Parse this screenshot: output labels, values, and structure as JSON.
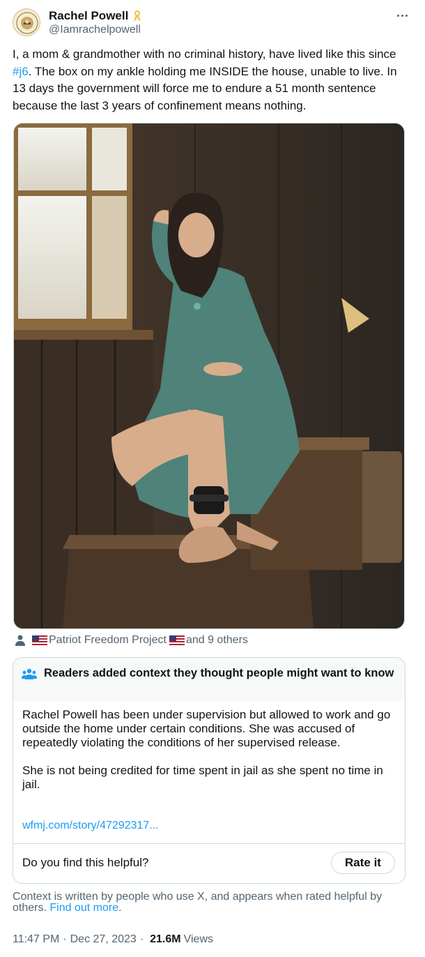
{
  "author": {
    "display_name": "Rachel Powell",
    "handle": "@Iamrachelpowell",
    "avatar_icon": "profile-avatar-icon",
    "badge_icon": "gold-ribbon-icon"
  },
  "tweet": {
    "text_before_hashtag": "I, a mom & grandmother with no criminal history, have lived like this since ",
    "hashtag": "#j6",
    "text_after_hashtag": ". The box on my ankle holding me INSIDE the house, unable to live. In 13 days the government will force me to endure a 51 month sentence because the last 3 years of confinement means nothing."
  },
  "tags": {
    "first": "Patriot Freedom Project",
    "rest": "and 9 others"
  },
  "community_note": {
    "title": "Readers added context they thought people might want to know",
    "paragraph_1": "Rachel Powell has been under supervision but allowed to work and go outside the home under certain conditions.  She was accused of repeatedly violating the conditions of her supervised release.",
    "paragraph_2": "She is not being credited for time spent in jail as she spent no time in jail.",
    "link": "wfmj.com/story/47292317...",
    "helpful_prompt": "Do you find this helpful?",
    "rate_label": "Rate it"
  },
  "context_footer": {
    "text": "Context is written by people who use X, and appears when rated helpful by others. ",
    "link": "Find out more",
    "end": "."
  },
  "meta": {
    "time": "11:47 PM",
    "date": "Dec 27, 2023",
    "views_count": "21.6M",
    "views_label": "Views"
  },
  "colors": {
    "accent": "#1d9bf0",
    "secondary_text": "#536471",
    "border": "#cfd9de"
  }
}
